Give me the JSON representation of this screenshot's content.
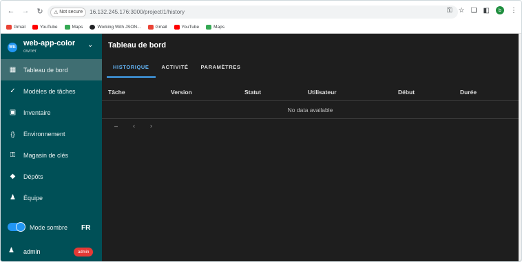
{
  "browser": {
    "secure_label": "Not secure",
    "url": "16.132.245.176:3000/project/1/history",
    "profile_letter": "b",
    "bookmarks": [
      {
        "label": "Gmail",
        "color": "#ea4335"
      },
      {
        "label": "YouTube",
        "color": "#ff0000"
      },
      {
        "label": "Maps",
        "color": "#34a853"
      },
      {
        "label": "Working With JSON...",
        "color": "#202124"
      },
      {
        "label": "Gmail",
        "color": "#ea4335"
      },
      {
        "label": "YouTube",
        "color": "#ff0000"
      },
      {
        "label": "Maps",
        "color": "#34a853"
      }
    ]
  },
  "sidebar": {
    "project_avatar": "WE",
    "project_name": "web-app-color",
    "project_role": "owner",
    "items": [
      {
        "label": "Tableau de bord",
        "icon": "dashboard-icon"
      },
      {
        "label": "Modèles de tâches",
        "icon": "checks-icon"
      },
      {
        "label": "Inventaire",
        "icon": "monitor-icon"
      },
      {
        "label": "Environnement",
        "icon": "braces-icon"
      },
      {
        "label": "Magasin de clés",
        "icon": "key-icon"
      },
      {
        "label": "Dépôts",
        "icon": "git-icon"
      },
      {
        "label": "Équipe",
        "icon": "team-icon"
      }
    ],
    "dark_mode_label": "Mode sombre",
    "language": "FR",
    "user_name": "admin",
    "user_badge": "admin"
  },
  "main": {
    "title": "Tableau de bord",
    "tabs": [
      "HISTORIQUE",
      "ACTIVITÉ",
      "PARAMÈTRES"
    ],
    "columns": [
      "Tâche",
      "Version",
      "Statut",
      "Utilisateur",
      "Début",
      "Durée"
    ],
    "empty_text": "No data available"
  },
  "colors": {
    "sidebar": "#005057",
    "accent": "#2196f3",
    "badge": "#e53935"
  }
}
